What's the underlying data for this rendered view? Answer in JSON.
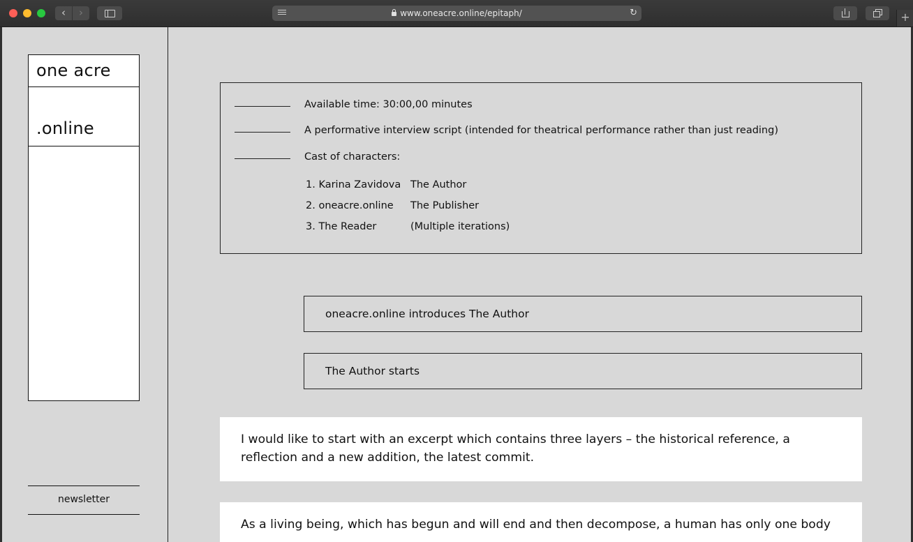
{
  "browser": {
    "url": "www.oneacre.online/epitaph/",
    "icons": {
      "back": "chevron-left-icon",
      "forward": "chevron-right-icon",
      "sidebar": "sidebar-icon",
      "reader": "reader-icon",
      "lock": "lock-icon",
      "reload": "reload-icon",
      "share": "share-icon",
      "tabs": "tabs-icon",
      "new_tab": "plus-icon"
    },
    "colors": {
      "close": "#fe5f57",
      "minimize": "#febc2e",
      "zoom": "#28c840"
    }
  },
  "sidebar": {
    "logo_line1": "one acre",
    "logo_line2": ".online",
    "newsletter_label": "newsletter"
  },
  "info": {
    "available_time": "Available time: 30:00,00 minutes",
    "script_description": "A performative interview script (intended for theatrical performance rather than just reading)",
    "cast_heading": "Cast of characters:",
    "cast": [
      {
        "name": "1. Karina Zavidova",
        "role": "The Author"
      },
      {
        "name": "2. oneacre.online",
        "role": "The Publisher"
      },
      {
        "name": "3. The Reader",
        "role": "(Multiple iterations)"
      }
    ]
  },
  "steps": [
    "oneacre.online introduces The Author",
    "The Author starts"
  ],
  "quotes": [
    "I would like to start with an excerpt which contains three layers – the historical reference, a reflection and a new addition, the latest commit.",
    "As a living being, which has begun and will end and then decompose, a human has only one body"
  ],
  "colors": {
    "page_background": "#d8d8d8",
    "ink": "#111111",
    "card_background": "#ffffff"
  }
}
